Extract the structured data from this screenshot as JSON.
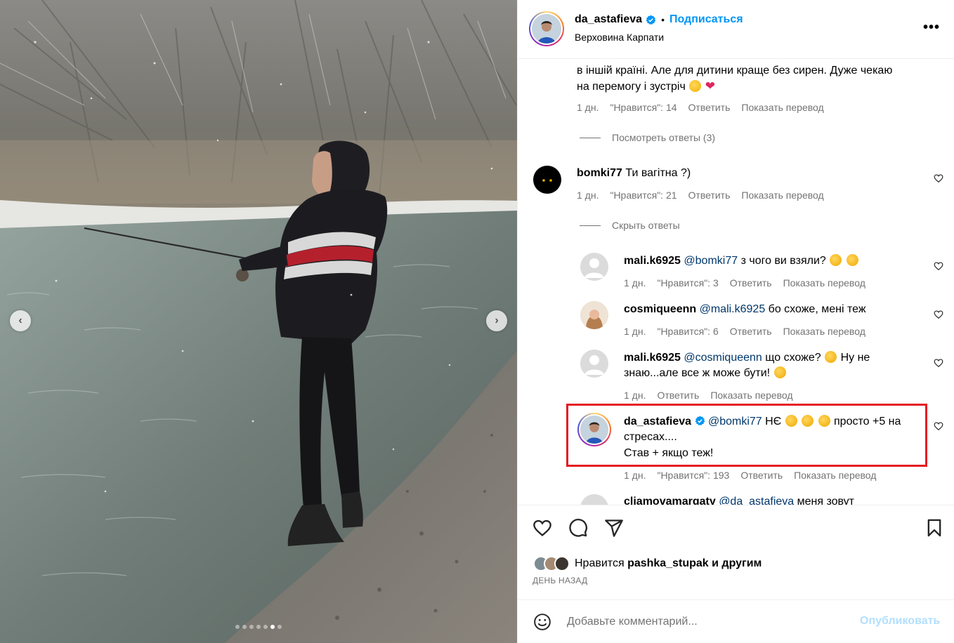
{
  "post": {
    "username": "da_astafieva",
    "follow_label": "Подписаться",
    "location": "Верховина Карпати",
    "more_label": "•••"
  },
  "comments": {
    "first": {
      "line1": "в іншій країні. Але для дитини краще без сирен. Дуже чекаю",
      "line2": "на перемогу і зустріч",
      "time": "1 дн.",
      "likes": "\"Нравится\": 14",
      "reply": "Ответить",
      "translate": "Показать перевод",
      "view_replies": "Посмотреть ответы (3)"
    },
    "bomki": {
      "username": "bomki77",
      "text": "Ти вагітна ?)",
      "time": "1 дн.",
      "likes": "\"Нравится\": 21",
      "reply": "Ответить",
      "translate": "Показать перевод",
      "hide_replies": "Скрыть ответы"
    },
    "replies": [
      {
        "username": "mali.k6925",
        "mention": "@bomki77",
        "text": "з чого ви взяли?",
        "time": "1 дн.",
        "likes": "\"Нравится\": 3",
        "reply": "Ответить",
        "translate": "Показать перевод"
      },
      {
        "username": "cosmiqueenn",
        "mention": "@mali.k6925",
        "text": "бо схоже, мені теж",
        "time": "1 дн.",
        "likes": "\"Нравится\": 6",
        "reply": "Ответить",
        "translate": "Показать перевод"
      },
      {
        "username": "mali.k6925",
        "mention": "@cosmiqueenn",
        "text1": "що схоже?",
        "text2": "Ну не",
        "line2": "знаю...але все ж може бути!",
        "time": "1 дн.",
        "reply": "Ответить",
        "translate": "Показать перевод"
      },
      {
        "username": "da_astafieva",
        "mention": "@bomki77",
        "text1": "НЄ",
        "text2": "просто +5 на",
        "line2": "стресах....",
        "line3": "Став + якщо теж!",
        "time": "1 дн.",
        "likes": "\"Нравится\": 193",
        "reply": "Ответить",
        "translate": "Показать перевод"
      }
    ],
    "partial": {
      "username": "cliamovamargaty",
      "mention": "@da_astafieva",
      "text": "меня зовут"
    }
  },
  "actions": {
    "liked_by_prefix": "Нравится",
    "liked_by_user": "pashka_stupak",
    "liked_by_suffix": "и другим",
    "time_ago": "ДЕНЬ НАЗАД",
    "comment_placeholder": "Добавьте комментарий...",
    "publish_label": "Опубликовать"
  },
  "icons": [
    "verified-badge-icon",
    "more-icon",
    "heart-icon",
    "comment-icon",
    "share-icon",
    "bookmark-icon",
    "emoji-icon",
    "prev-arrow-icon",
    "next-arrow-icon"
  ],
  "colors": {
    "link": "#0095f6",
    "mention": "#00376b",
    "muted": "#737373",
    "highlight": "#e51b23",
    "publish_disabled": "#b2dffc"
  },
  "carousel": {
    "slide_count": 6,
    "active_index": 5
  }
}
